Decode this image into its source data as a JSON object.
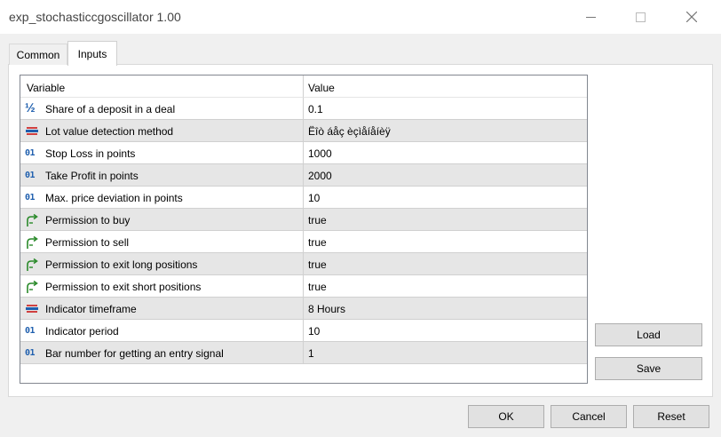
{
  "window": {
    "title": "exp_stochasticcgoscillator 1.00"
  },
  "tabs": [
    {
      "label": "Common"
    },
    {
      "label": "Inputs"
    }
  ],
  "grid": {
    "headers": {
      "variable": "Variable",
      "value": "Value"
    },
    "rows": [
      {
        "icon": "fraction-icon",
        "variable": "Share of a deposit in a deal",
        "value": "0.1"
      },
      {
        "icon": "enum-icon",
        "variable": "Lot value detection method",
        "value": "Ëîò áåç èçìåíåíèÿ"
      },
      {
        "icon": "integer-icon",
        "variable": "Stop Loss in points",
        "value": "1000"
      },
      {
        "icon": "integer-icon",
        "variable": "Take Profit in points",
        "value": "2000"
      },
      {
        "icon": "integer-icon",
        "variable": "Max. price deviation in points",
        "value": "10"
      },
      {
        "icon": "boolean-icon",
        "variable": "Permission to buy",
        "value": "true"
      },
      {
        "icon": "boolean-icon",
        "variable": "Permission to sell",
        "value": "true"
      },
      {
        "icon": "boolean-icon",
        "variable": "Permission to exit long positions",
        "value": "true"
      },
      {
        "icon": "boolean-icon",
        "variable": "Permission to exit short positions",
        "value": "true"
      },
      {
        "icon": "enum-icon",
        "variable": "Indicator timeframe",
        "value": "8 Hours"
      },
      {
        "icon": "integer-icon",
        "variable": "Indicator period",
        "value": "10"
      },
      {
        "icon": "integer-icon",
        "variable": "Bar number for getting an entry signal",
        "value": "1"
      }
    ]
  },
  "buttons": {
    "load": "Load",
    "save": "Save",
    "ok": "OK",
    "cancel": "Cancel",
    "reset": "Reset"
  },
  "icon_glyphs": {
    "integer": "01",
    "fraction": "½"
  },
  "colors": {
    "icon_blue": "#1f5fae",
    "bool_green": "#2a8a2a",
    "enum_red": "#d04040"
  }
}
